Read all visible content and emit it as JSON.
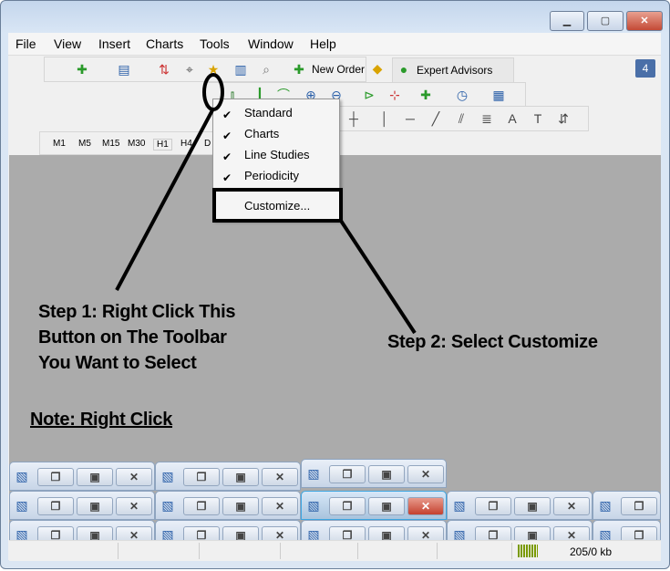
{
  "window": {
    "controls": [
      "minimize",
      "maximize",
      "close"
    ]
  },
  "menu": [
    "File",
    "View",
    "Insert",
    "Charts",
    "Tools",
    "Window",
    "Help"
  ],
  "toolbar": {
    "new_order": "New Order",
    "expert_advisors": "Expert Advisors",
    "notification_count": "4"
  },
  "timeframes": [
    "M1",
    "M5",
    "M15",
    "M30",
    "H1",
    "H4",
    "D"
  ],
  "context_menu": {
    "items": [
      {
        "label": "Standard",
        "checked": true
      },
      {
        "label": "Charts",
        "checked": true
      },
      {
        "label": "Line Studies",
        "checked": true
      },
      {
        "label": "Periodicity",
        "checked": true
      }
    ],
    "customize": "Customize..."
  },
  "annotations": {
    "step1": [
      "Step 1: Right Click This",
      "Button on The Toolbar",
      "You Want to Select"
    ],
    "step2": "Step 2: Select Customize",
    "note": "Note: Right Click"
  },
  "status": {
    "traffic": "205/0 kb"
  },
  "mini_windows": {
    "rows": [
      3,
      5,
      5
    ],
    "active": {
      "row": 1,
      "col": 2
    }
  },
  "colors": {
    "background": "#ababab",
    "annotation": "#000000"
  }
}
